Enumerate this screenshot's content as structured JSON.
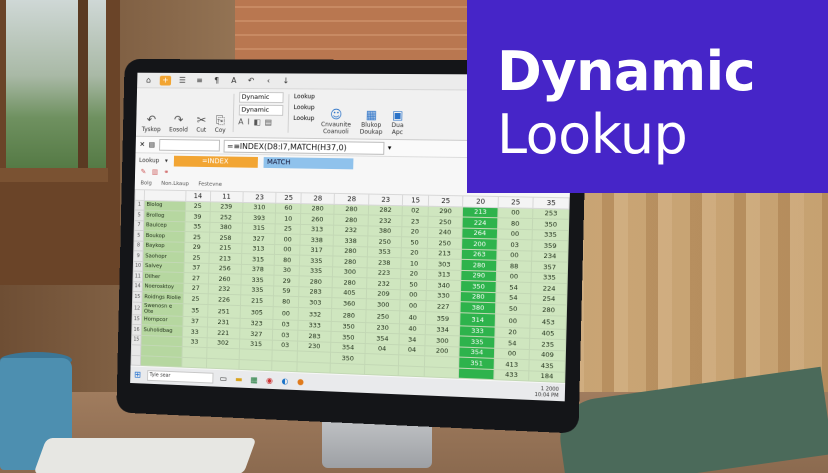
{
  "title": {
    "line1": "Dynamic",
    "line2": "Lookup",
    "bg_color": "#4625c8",
    "text_color": "#ffffff"
  },
  "ribbon": {
    "qat_icons": [
      "home-icon",
      "plus-icon",
      "list-icon",
      "align-icon",
      "paragraph-icon",
      "back-icon",
      "down-icon"
    ],
    "groups": [
      {
        "label": "Tyskop"
      },
      {
        "label": "Eosold"
      },
      {
        "label": "Cut"
      },
      {
        "label": "Coy"
      }
    ],
    "dropdowns": [
      "Dynamic",
      "Dynamic"
    ],
    "lookups": [
      "Lookup",
      "Lookup",
      "Lookup"
    ],
    "big_buttons": [
      {
        "label": "Cnvaunite\nCoanuoli"
      },
      {
        "label": "Blukop\nDoukap"
      },
      {
        "label": "Dua\nApc"
      }
    ]
  },
  "formula_bar": {
    "name_box": "",
    "fx": "fx",
    "formula": "=≡INDEX(D8:I7,MATCH(H37,0)"
  },
  "lookup_bar": {
    "label": "Lookup",
    "index_label": "=INDEX",
    "match_label": "MATCH"
  },
  "sheet_tabs": [
    "Bolg",
    "Non.Lkaup",
    "Festevne"
  ],
  "header_row": [
    "14",
    "11",
    "23",
    "25",
    "28",
    "28",
    "23",
    "15",
    "25",
    "20",
    "25",
    "35"
  ],
  "rows": [
    {
      "n": "1",
      "label": "Blolog",
      "vals": [
        "25",
        "239",
        "310",
        "60",
        "280",
        "280",
        "282",
        "02",
        "290",
        "213",
        "00",
        "253"
      ]
    },
    {
      "n": "5",
      "label": "Brollog",
      "vals": [
        "39",
        "252",
        "393",
        "10",
        "260",
        "280",
        "232",
        "23",
        "250",
        "224",
        "80",
        "350"
      ]
    },
    {
      "n": "7",
      "label": "Baulcep",
      "vals": [
        "35",
        "380",
        "315",
        "25",
        "313",
        "232",
        "380",
        "20",
        "240",
        "264",
        "00",
        "335"
      ]
    },
    {
      "n": "5",
      "label": "Boukop",
      "vals": [
        "25",
        "258",
        "327",
        "00",
        "338",
        "338",
        "250",
        "50",
        "250",
        "200",
        "03",
        "359"
      ]
    },
    {
      "n": "8",
      "label": "Baykop",
      "vals": [
        "29",
        "215",
        "313",
        "00",
        "317",
        "280",
        "353",
        "20",
        "213",
        "263",
        "00",
        "234"
      ]
    },
    {
      "n": "9",
      "label": "Saohopr",
      "vals": [
        "25",
        "213",
        "315",
        "80",
        "335",
        "280",
        "238",
        "10",
        "303",
        "280",
        "88",
        "357"
      ]
    },
    {
      "n": "10",
      "label": "Salvey",
      "vals": [
        "37",
        "256",
        "378",
        "30",
        "335",
        "300",
        "223",
        "20",
        "313",
        "290",
        "00",
        "335"
      ]
    },
    {
      "n": "11",
      "label": "Dilher",
      "vals": [
        "27",
        "260",
        "335",
        "29",
        "280",
        "280",
        "232",
        "50",
        "340",
        "350",
        "54",
        "224"
      ]
    },
    {
      "n": "14",
      "label": "Noerosktoy",
      "vals": [
        "27",
        "232",
        "335",
        "59",
        "283",
        "405",
        "209",
        "00",
        "330",
        "280",
        "54",
        "254"
      ]
    },
    {
      "n": "15",
      "label": "Roidngs Riolie",
      "vals": [
        "25",
        "226",
        "215",
        "80",
        "303",
        "360",
        "300",
        "00",
        "227",
        "380",
        "50",
        "280"
      ]
    },
    {
      "n": "12",
      "label": "Swenosn e Ote",
      "vals": [
        "35",
        "251",
        "305",
        "00",
        "332",
        "280",
        "250",
        "40",
        "359",
        "314",
        "00",
        "453"
      ]
    },
    {
      "n": "15",
      "label": "Hornpcor",
      "vals": [
        "37",
        "231",
        "323",
        "03",
        "333",
        "350",
        "230",
        "40",
        "334",
        "333",
        "20",
        "405"
      ]
    },
    {
      "n": "16",
      "label": "Suholidbag",
      "vals": [
        "33",
        "221",
        "327",
        "03",
        "283",
        "350",
        "354",
        "34",
        "300",
        "335",
        "54",
        "235"
      ]
    },
    {
      "n": "15",
      "label": "",
      "vals": [
        "33",
        "302",
        "315",
        "03",
        "230",
        "354",
        "04",
        "04",
        "200",
        "354",
        "00",
        "409"
      ]
    },
    {
      "n": "",
      "label": "",
      "vals": [
        "",
        "",
        "",
        "",
        "",
        "350",
        "",
        "",
        "",
        "351",
        "413",
        "435"
      ]
    },
    {
      "n": "",
      "label": "",
      "vals": [
        "",
        "",
        "",
        "",
        "",
        "",
        "",
        "",
        "",
        "",
        "433",
        "184"
      ]
    }
  ],
  "highlight_col": 9,
  "taskbar": {
    "search_placeholder": "Tyie sear",
    "clock_line1": "1 2000",
    "clock_line2": "10:04 PM"
  }
}
